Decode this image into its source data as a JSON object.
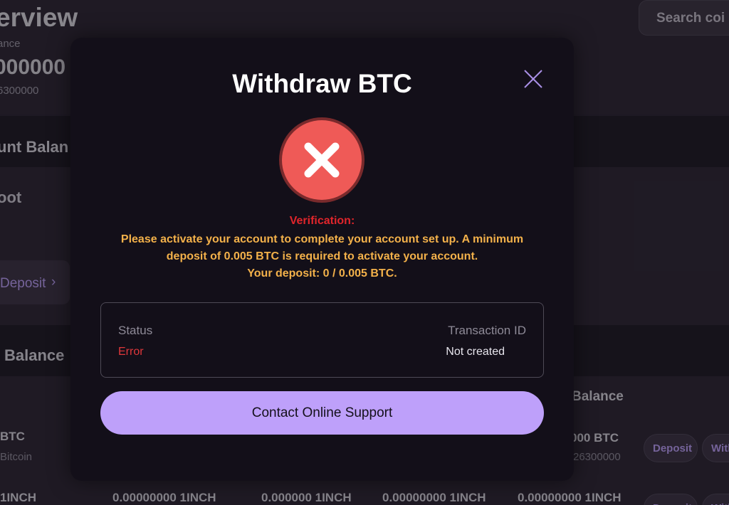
{
  "background": {
    "page_title": "erview",
    "balance_label": "ance",
    "balance_value": "000000",
    "balance_sub": "6300000",
    "search_placeholder": "Search coi",
    "account_balance_heading": "unt Balan",
    "spot_label": "oot",
    "deposit_label": "Deposit",
    "deposit_chevron": "›",
    "balance_heading": "Balance",
    "column_header_balance": "Balance",
    "rows": [
      {
        "symbol": "BTC",
        "name": "Bitcoin",
        "balance": "000 BTC",
        "balance_sub": "26300000",
        "deposit_button": "Deposit",
        "withdraw_button": "With"
      },
      {
        "symbol": "1INCH",
        "cells": [
          "0.00000000 1INCH",
          "0.000000 1INCH",
          "0.00000000 1INCH",
          "0.00000000 1INCH"
        ],
        "deposit_button": "Deposit",
        "withdraw_button": "With"
      }
    ]
  },
  "modal": {
    "title": "Withdraw BTC",
    "close_icon": "close-icon",
    "status_icon": "error-x-icon",
    "verification_label": "Verification:",
    "message_line1": "Please activate your account to complete your account set up. A minimum",
    "message_line2": "deposit of 0.005 BTC is required to activate your account.",
    "message_line3": "Your deposit: 0 / 0.005 BTC.",
    "status_label": "Status",
    "status_value": "Error",
    "transaction_label": "Transaction ID",
    "transaction_value": "Not created",
    "support_button": "Contact Online Support"
  },
  "colors": {
    "modal_bg": "#130f19",
    "accent_purple": "#bea0fa",
    "error_red": "#e0373b",
    "warning_orange": "#f3b14a",
    "icon_red": "#ef5a57"
  }
}
